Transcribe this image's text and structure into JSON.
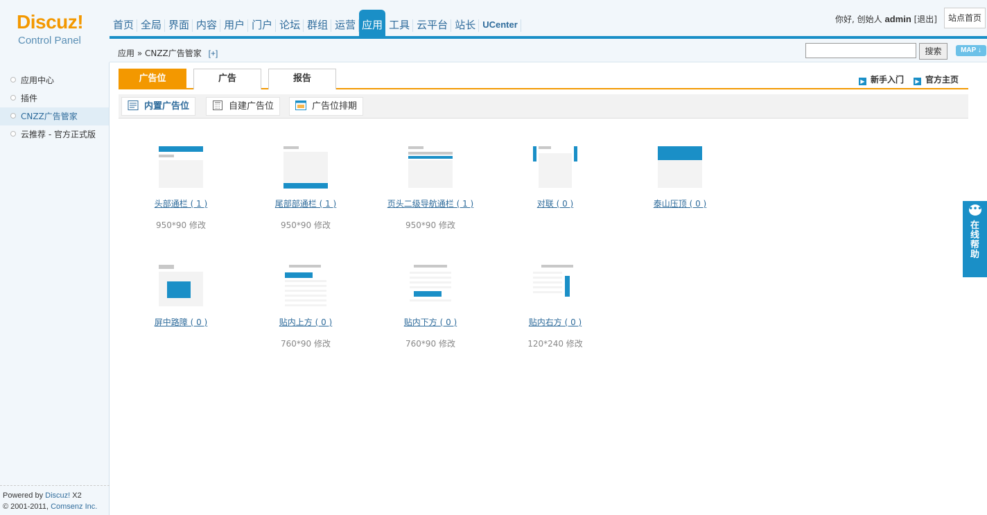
{
  "logo": {
    "brand": "Discuz!",
    "subtitle": "Control Panel"
  },
  "nav": {
    "items": [
      {
        "label": "首页"
      },
      {
        "label": "全局"
      },
      {
        "label": "界面"
      },
      {
        "label": "内容"
      },
      {
        "label": "用户"
      },
      {
        "label": "门户"
      },
      {
        "label": "论坛"
      },
      {
        "label": "群组"
      },
      {
        "label": "运营"
      },
      {
        "label": "应用"
      },
      {
        "label": "工具"
      },
      {
        "label": "云平台"
      },
      {
        "label": "站长"
      },
      {
        "label": "UCenter"
      }
    ],
    "active": "应用"
  },
  "user": {
    "greeting": "你好, 创始人",
    "name": "admin",
    "logout": "[退出]",
    "home_button": "站点首页"
  },
  "breadcrumb": {
    "path": "应用 » CNZZ广告管家",
    "add": "[+]"
  },
  "search": {
    "value": "",
    "button": "搜索",
    "map": "MAP ↓"
  },
  "sidebar": {
    "items": [
      {
        "label": "应用中心"
      },
      {
        "label": "插件"
      },
      {
        "label": "CNZZ广告管家"
      },
      {
        "label": "云推荐 - 官方正式版"
      }
    ],
    "active_index": 2
  },
  "footer": {
    "line1_prefix": "Powered by ",
    "line1_link": "Discuz!",
    "line1_suffix": " X2",
    "line2_prefix": "© 2001-2011, ",
    "line2_link": "Comsenz Inc."
  },
  "tabs": [
    {
      "label": "广告位"
    },
    {
      "label": "广告"
    },
    {
      "label": "报告"
    }
  ],
  "quick_links": {
    "beginner": "新手入门",
    "official": "官方主页"
  },
  "subtabs": [
    {
      "label": "内置广告位"
    },
    {
      "label": "自建广告位"
    },
    {
      "label": "广告位排期"
    }
  ],
  "ad_slots": [
    {
      "title": "头部通栏 ( 1 )",
      "dims": "950*90 修改"
    },
    {
      "title": "尾部部通栏 ( 1 )",
      "dims": "950*90 修改"
    },
    {
      "title": "页头二级导航通栏 ( 1 )",
      "dims": "950*90 修改"
    },
    {
      "title": "对联 ( 0 )",
      "dims": ""
    },
    {
      "title": "泰山压顶 ( 0 )",
      "dims": ""
    },
    {
      "title": "屏中路障 ( 0 )",
      "dims": ""
    },
    {
      "title": "贴内上方 ( 0 )",
      "dims": "760*90 修改"
    },
    {
      "title": "贴内下方 ( 0 )",
      "dims": "760*90 修改"
    },
    {
      "title": "贴内右方 ( 0 )",
      "dims": "120*240 修改"
    }
  ],
  "help": {
    "label": "在线帮助"
  },
  "colors": {
    "accent": "#1a8fc7",
    "tab_active": "#f39800",
    "brand": "#f39800"
  }
}
